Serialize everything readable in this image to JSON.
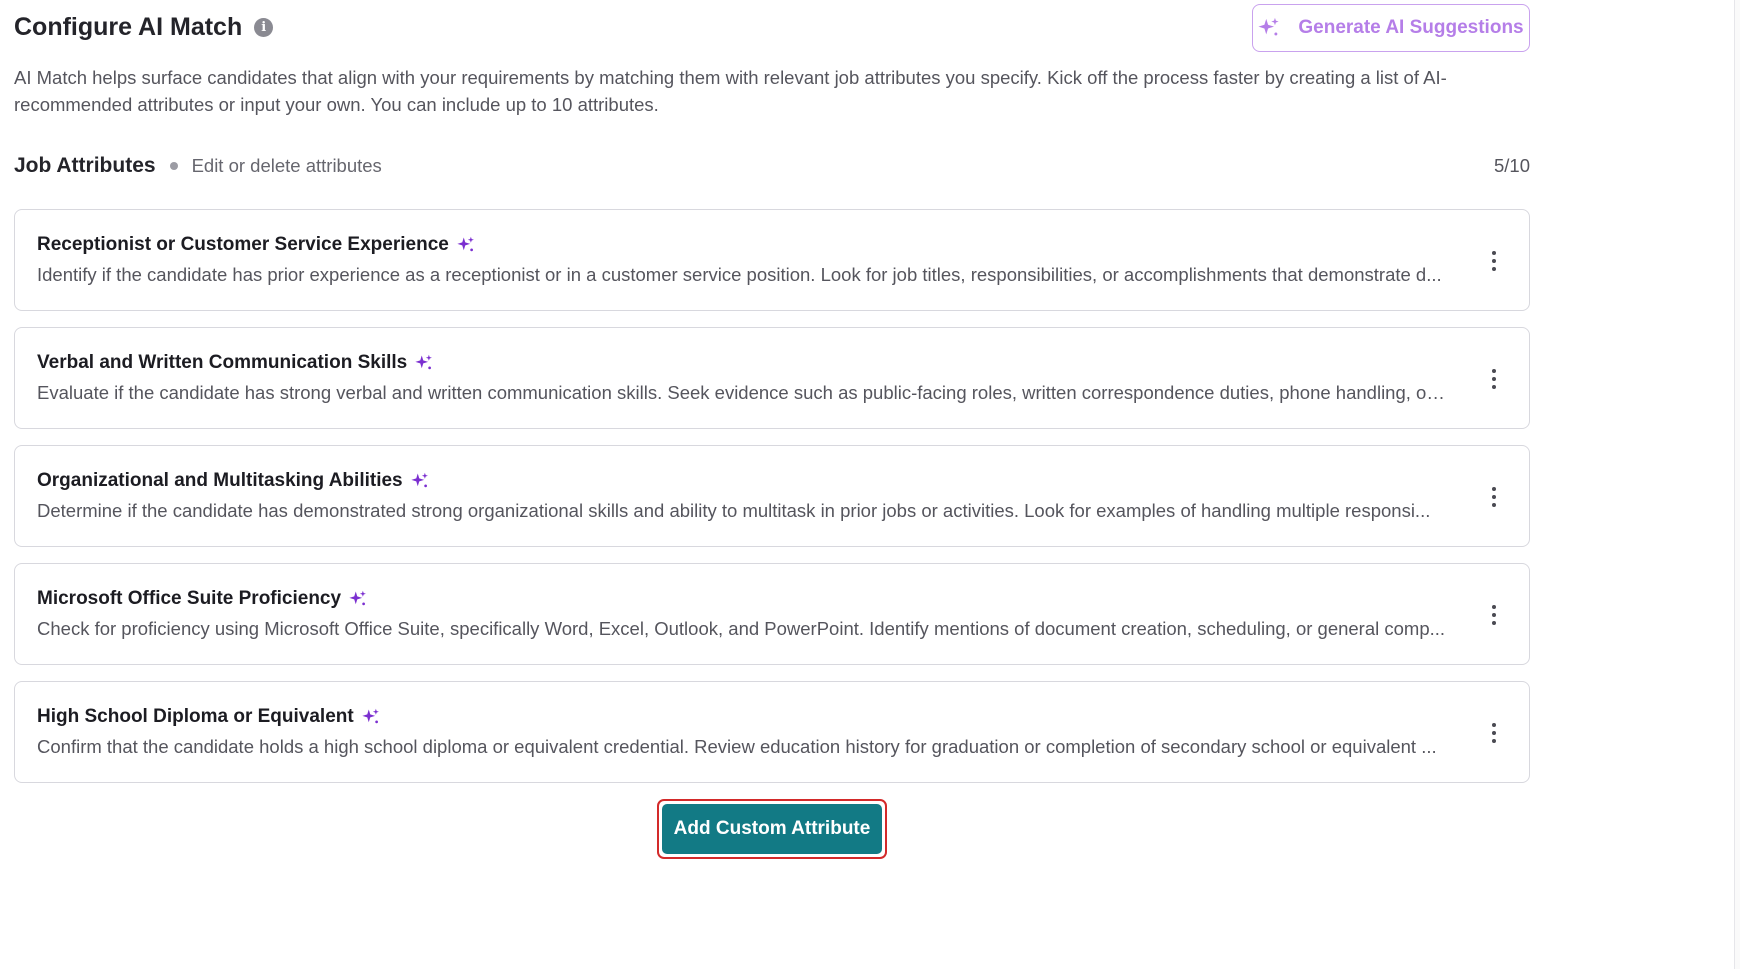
{
  "header": {
    "title": "Configure AI Match",
    "info_icon": "i",
    "generate_button": "Generate AI Suggestions",
    "description": "AI Match helps surface candidates that align with your requirements by matching them with relevant job attributes you specify. Kick off the process faster by creating a list of AI-recommended attributes or input your own. You can include up to 10 attributes."
  },
  "attributes_section": {
    "title": "Job Attributes",
    "subtitle": "Edit or delete attributes",
    "count": "5/10"
  },
  "attributes": [
    {
      "title": "Receptionist or Customer Service Experience",
      "description": "Identify if the candidate has prior experience as a receptionist or in a customer service position. Look for job titles, responsibilities, or accomplishments that demonstrate d..."
    },
    {
      "title": "Verbal and Written Communication Skills",
      "description": "Evaluate if the candidate has strong verbal and written communication skills. Seek evidence such as public-facing roles, written correspondence duties, phone handling, or ..."
    },
    {
      "title": "Organizational and Multitasking Abilities",
      "description": "Determine if the candidate has demonstrated strong organizational skills and ability to multitask in prior jobs or activities. Look for examples of handling multiple responsi..."
    },
    {
      "title": "Microsoft Office Suite Proficiency",
      "description": "Check for proficiency using Microsoft Office Suite, specifically Word, Excel, Outlook, and PowerPoint. Identify mentions of document creation, scheduling, or general comp..."
    },
    {
      "title": "High School Diploma or Equivalent",
      "description": "Confirm that the candidate holds a high school diploma or equivalent credential. Review education history for graduation or completion of secondary school or equivalent ..."
    }
  ],
  "footer": {
    "add_button": "Add Custom Attribute"
  },
  "colors": {
    "accent_purple": "#7b2fd0",
    "generate_purple": "#b57ee8",
    "primary_teal": "#127a85",
    "highlight_red": "#d32a2a"
  },
  "icons": {
    "sparkle": "sparkle-icon",
    "info": "info-icon",
    "more": "more-vertical-icon"
  }
}
